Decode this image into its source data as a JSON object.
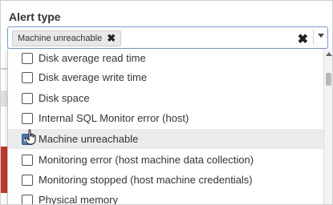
{
  "field": {
    "label": "Alert type",
    "selected_tag": "Machine unreachable",
    "tag_remove_glyph": "✖",
    "clear_glyph": "✖"
  },
  "dropdown": {
    "options": [
      {
        "label": "Disk average read time",
        "checked": false,
        "highlighted": false
      },
      {
        "label": "Disk average write time",
        "checked": false,
        "highlighted": false
      },
      {
        "label": "Disk space",
        "checked": false,
        "highlighted": false
      },
      {
        "label": "Internal SQL Monitor error (host)",
        "checked": false,
        "highlighted": false
      },
      {
        "label": "Machine unreachable",
        "checked": true,
        "highlighted": true
      },
      {
        "label": "Monitoring error (host machine data collection)",
        "checked": false,
        "highlighted": false
      },
      {
        "label": "Monitoring stopped (host machine credentials)",
        "checked": false,
        "highlighted": false
      },
      {
        "label": "Physical memory",
        "checked": false,
        "highlighted": false
      }
    ]
  },
  "colors": {
    "accent": "#4a78b6",
    "highlight": "#ececec",
    "alert_red": "#c0392b"
  },
  "icons": {
    "cursor": "hand-pointer-icon",
    "caret": "chevron-down-icon",
    "clear": "close-icon"
  }
}
